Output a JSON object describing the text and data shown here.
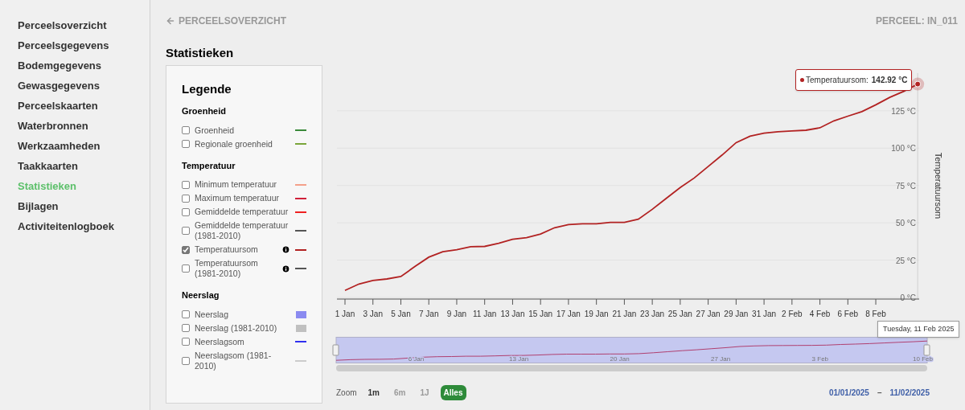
{
  "sidebar": {
    "items": [
      {
        "label": "Perceelsoverzicht",
        "selected": false
      },
      {
        "label": "Perceelsgegevens",
        "selected": false
      },
      {
        "label": "Bodemgegevens",
        "selected": false
      },
      {
        "label": "Gewasgegevens",
        "selected": false
      },
      {
        "label": "Perceelskaarten",
        "selected": false
      },
      {
        "label": "Waterbronnen",
        "selected": false
      },
      {
        "label": "Werkzaamheden",
        "selected": false
      },
      {
        "label": "Taakkaarten",
        "selected": false
      },
      {
        "label": "Statistieken",
        "selected": true
      },
      {
        "label": "Bijlagen",
        "selected": false
      },
      {
        "label": "Activiteitenlogboek",
        "selected": false
      }
    ]
  },
  "header": {
    "back_link": "PERCEELSOVERZICHT",
    "parcel": "PERCEEL: IN_011"
  },
  "title": "Statistieken",
  "legend": {
    "title": "Legende",
    "groups": [
      {
        "title": "Groenheid",
        "items": [
          {
            "label": "Groenheid",
            "checked": false,
            "kind": "line",
            "color": "#3a8a3a",
            "info": false
          },
          {
            "label": "Regionale groenheid",
            "checked": false,
            "kind": "line",
            "color": "#7aa53a",
            "info": false
          }
        ]
      },
      {
        "title": "Temperatuur",
        "items": [
          {
            "label": "Minimum temperatuur",
            "checked": false,
            "kind": "line",
            "color": "#f4a08a",
            "info": false
          },
          {
            "label": "Maximum temperatuur",
            "checked": false,
            "kind": "line",
            "color": "#d0203a",
            "info": false
          },
          {
            "label": "Gemiddelde temperatuur",
            "checked": false,
            "kind": "line",
            "color": "#ee2020",
            "info": false
          },
          {
            "label": "Gemiddelde temperatuur (1981-2010)",
            "checked": false,
            "kind": "line",
            "color": "#555555",
            "info": false
          },
          {
            "label": "Temperatuursom",
            "checked": true,
            "kind": "line",
            "color": "#b22222",
            "info": true
          },
          {
            "label": "Temperatuursom (1981-2010)",
            "checked": false,
            "kind": "line",
            "color": "#555555",
            "info": true
          }
        ]
      },
      {
        "title": "Neerslag",
        "items": [
          {
            "label": "Neerslag",
            "checked": false,
            "kind": "area",
            "color": "#8b8bf0",
            "info": false
          },
          {
            "label": "Neerslag (1981-2010)",
            "checked": false,
            "kind": "area",
            "color": "#c0c0c0",
            "info": false
          },
          {
            "label": "Neerslagsom",
            "checked": false,
            "kind": "line",
            "color": "#3030f0",
            "info": false
          },
          {
            "label": "Neerslagsom (1981-2010)",
            "checked": false,
            "kind": "line",
            "color": "#cccccc",
            "info": false
          }
        ]
      }
    ]
  },
  "chart": {
    "chart_data": {
      "type": "line",
      "ylabel": "Temperatuursom",
      "categories": [
        "1 Jan",
        null,
        "3 Jan",
        null,
        "5 Jan",
        null,
        "7 Jan",
        null,
        "9 Jan",
        null,
        "11 Jan",
        null,
        "13 Jan",
        null,
        "15 Jan",
        null,
        "17 Jan",
        null,
        "19 Jan",
        null,
        "21 Jan",
        null,
        "23 Jan",
        null,
        "25 Jan",
        null,
        "27 Jan",
        null,
        "29 Jan",
        null,
        "31 Jan",
        null,
        "2 Feb",
        null,
        "4 Feb",
        null,
        "6 Feb",
        null,
        "8 Feb",
        null,
        null,
        null
      ],
      "series": [
        {
          "name": "Temperatuursom",
          "color": "#b22222",
          "values": [
            4.7,
            9,
            11.4,
            12.4,
            14,
            20.7,
            27,
            30.6,
            32,
            34,
            34.2,
            36.3,
            39,
            40,
            42.5,
            46.7,
            48.8,
            49.3,
            49.3,
            50.3,
            50.3,
            52.4,
            59,
            66.4,
            73.6,
            80,
            87.7,
            95.4,
            103.7,
            108,
            110,
            111,
            111.5,
            112,
            113.6,
            118.3,
            121.4,
            124.5,
            129,
            134,
            138,
            142.9
          ]
        }
      ],
      "ylim": [
        0,
        150
      ],
      "grid": true,
      "yticks": [
        {
          "value": 0,
          "label": "0 °C"
        },
        {
          "value": 25,
          "label": "25 °C"
        },
        {
          "value": 50,
          "label": "50 °C"
        },
        {
          "value": 75,
          "label": "75 °C"
        },
        {
          "value": 100,
          "label": "100 °C"
        },
        {
          "value": 125,
          "label": "125 °C"
        }
      ]
    },
    "tooltip": {
      "suffix": ":",
      "value": "142.92 °C",
      "date": "Tuesday, 11 Feb 2025"
    },
    "navigator": {
      "labels": [
        "6 Jan",
        "13 Jan",
        "20 Jan",
        "27 Jan",
        "3 Feb",
        "10 Feb"
      ]
    }
  },
  "zoom": {
    "label": "Zoom",
    "buttons": [
      {
        "label": "1m",
        "selected": false,
        "disabled": false
      },
      {
        "label": "6m",
        "selected": false,
        "disabled": true
      },
      {
        "label": "1J",
        "selected": false,
        "disabled": true
      },
      {
        "label": "Alles",
        "selected": true,
        "disabled": false
      }
    ]
  },
  "range": {
    "from": "01/01/2025",
    "separator": "–",
    "to": "11/02/2025"
  }
}
